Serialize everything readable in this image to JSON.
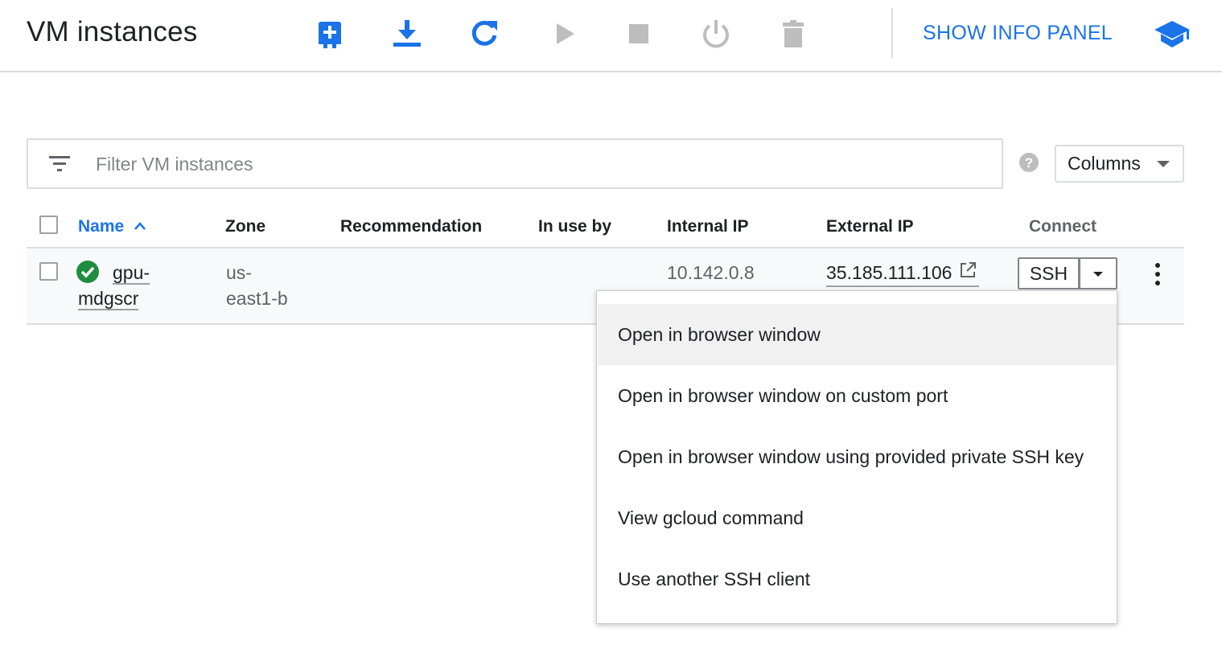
{
  "header": {
    "title": "VM instances",
    "toolbar": [
      {
        "name": "create-instance-button",
        "icon": "add-box-icon",
        "color": "#1a73e8"
      },
      {
        "name": "import-vm-button",
        "icon": "download-icon",
        "color": "#1a73e8"
      },
      {
        "name": "refresh-button",
        "icon": "refresh-icon",
        "color": "#1a73e8"
      },
      {
        "name": "start-button",
        "icon": "play-icon",
        "color": "#bdbdbd"
      },
      {
        "name": "stop-button",
        "icon": "stop-icon",
        "color": "#bdbdbd"
      },
      {
        "name": "reset-button",
        "icon": "power-icon",
        "color": "#bdbdbd"
      },
      {
        "name": "delete-button",
        "icon": "trash-icon",
        "color": "#bdbdbd"
      }
    ],
    "info_panel_label": "SHOW INFO PANEL",
    "learn_icon": "school-icon"
  },
  "filter": {
    "placeholder": "Filter VM instances",
    "value": ""
  },
  "columns_label": "Columns",
  "table": {
    "columns": [
      "Name",
      "Zone",
      "Recommendation",
      "In use by",
      "Internal IP",
      "External IP",
      "Connect"
    ],
    "sorted_column": "Name",
    "rows": [
      {
        "status": "running",
        "name_line1": "gpu-",
        "name_line2": "mdgscr",
        "zone_line1": "us-",
        "zone_line2": "east1-b",
        "recommendation": "",
        "in_use_by": "",
        "internal_ip": "10.142.0.8",
        "external_ip": "35.185.111.106",
        "connect_label": "SSH"
      }
    ]
  },
  "ssh_menu": {
    "items": [
      "Open in browser window",
      "Open in browser window on custom port",
      "Open in browser window using provided private SSH key",
      "View gcloud command",
      "Use another SSH client"
    ],
    "highlighted_index": 0
  },
  "colors": {
    "accent": "#1a73e8",
    "status_ok": "#1e8e3e",
    "disabled": "#bdbdbd",
    "border": "#dadce0"
  }
}
